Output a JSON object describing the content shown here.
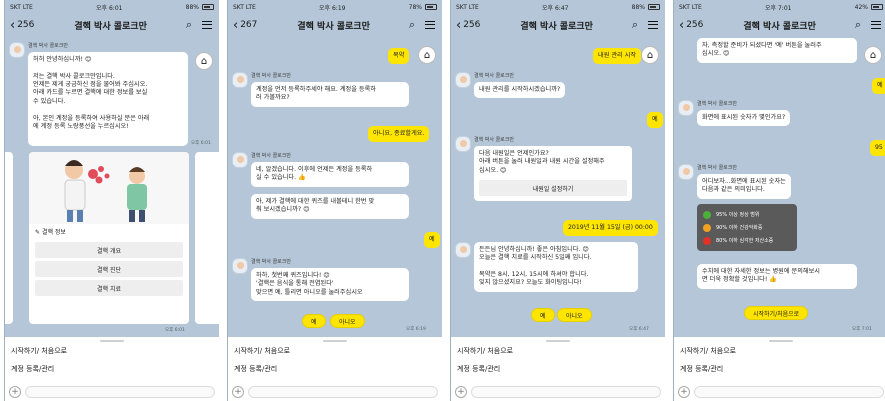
{
  "screens": [
    {
      "status": {
        "carrier": "SKT LTE",
        "time": "오후 6:01",
        "battery": "88%"
      },
      "header": {
        "back_count": "256",
        "title": "결핵 박사 콜로크만"
      },
      "bot_name": "결핵 박사 콜로크만",
      "bubble_1": "허허 안녕하십니까! 😊\n\n저는 결핵 박사 콜로크만입니다.\n언제든 제게 궁금하신 점을 물어봐 주십시오.\n아래 카드를 누르면 결핵에 대한 정보를 보실\n수 있습니다.\n\n아, 본인 계정을 등록하여 사용하실 분은 아래\n에 계정 등록 노랑풍선을 누르십시오!",
      "card_title": "결핵 정보",
      "card_buttons": [
        "결핵 개요",
        "결핵 진단",
        "결핵 치료"
      ],
      "time_1": "오후 6:01",
      "time_2": "오후 6:01",
      "menu": [
        "시작하기/ 처음으로",
        "계정 등록/관리"
      ]
    },
    {
      "status": {
        "carrier": "SKT LTE",
        "time": "오후 6:19",
        "battery": "78%"
      },
      "header": {
        "back_count": "267",
        "title": "결핵 박사 콜로크만"
      },
      "bot_name": "결핵 박사 콜로크만",
      "top_me": "복약",
      "bubble_1": "계정을 먼저 등록하주세야 해요. 계정을 등록하\n러 가볼까요?",
      "me_1": "아니요, 종료할게요.",
      "bubble_2": "네, 알겠습니다. 이후에 언제든 계정을 등록하\n실 수 있습니다. 👍",
      "bubble_3": "아, 제가 결핵에 대한 퀴즈를 내볼테니 한번 맞\n춰 보시겠습니까? 😊",
      "me_2": "예",
      "bubble_4": "하하, 첫번째 퀴즈입니다! 😊\n'결핵은 음식을 통해 전염된다'\n맞으면 예, 틀리면 아니오를 눌러주십시오",
      "quick_replies": [
        "예",
        "아니오"
      ],
      "time": "오후 6:19",
      "menu": [
        "시작하기/ 처음으로",
        "계정 등록/관리"
      ]
    },
    {
      "status": {
        "carrier": "SKT LTE",
        "time": "오후 6:47",
        "battery": "88%"
      },
      "header": {
        "back_count": "256",
        "title": "결핵 박사 콜로크만"
      },
      "bot_name": "결핵 박사 콜로크만",
      "top_me": "내원 관리 시작",
      "bubble_1": "내원 관리를 시작하시겠습니까?",
      "me_1": "예",
      "bubble_2": "다음 내원일은 언제인가요?\n아래 버튼을 눌러 내원일과 내원 시간을 설정해주\n십시오. 😊",
      "bubble_2_button": "내원일 설정하기",
      "me_2": "2019년 11월 15일 (금) 00:00",
      "bubble_3": "든든님 안녕하십니까! 좋은 아침입니다. 😊\n오늘은 결핵 치료를 시작하신 5일째 입니다.\n\n복약은 8시, 12시, 15시에 하셔야 합니다.\n잊지 않으셨지요? 오늘도 화이팅입니다!",
      "quick_replies": [
        "예",
        "아니오"
      ],
      "time": "오후 6:47",
      "menu": [
        "시작하기/ 처음으로",
        "계정 등록/관리"
      ]
    },
    {
      "status": {
        "carrier": "SKT LTE",
        "time": "오후 7:01",
        "battery": "42%"
      },
      "header": {
        "back_count": "256",
        "title": "결핵 박사 콜로크만"
      },
      "bot_name": "결핵 박사 콜로크만",
      "bubble_top": "자, 측정할 준비가 되셨다면 '예' 버튼을 눌러주\n십시오. 😊",
      "me_1": "예",
      "bubble_1": "화면에 표시된 숫자가 몇인가요?",
      "me_2": "95",
      "bubble_2": "어디보자...화면에 표시된 숫자는\n다음과 같은 의미입니다.",
      "legend": [
        {
          "text": "95% 이상 정상 범위",
          "color": "#4caf3a"
        },
        {
          "text": "90% 이하 건강악화증",
          "color": "#f4a020"
        },
        {
          "text": "80% 이하 심각한 저산소증",
          "color": "#e23228"
        }
      ],
      "bubble_3": "수치에 대한 자세한 정보는 병원에 문의해보시\n면 더욱 정확할 것입니다! 👍",
      "quick_reply": "시작하기/처음으로",
      "time": "오후 7:01",
      "menu": [
        "시작하기/ 처음으로",
        "계정 등록/관리"
      ]
    }
  ]
}
